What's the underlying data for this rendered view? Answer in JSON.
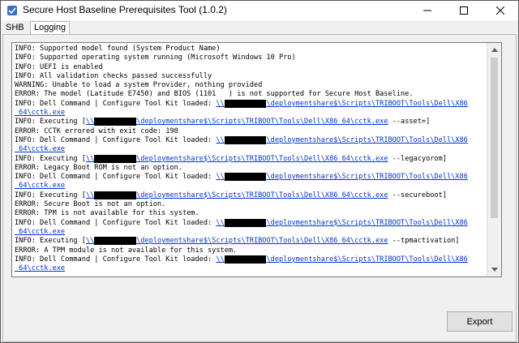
{
  "window": {
    "title": "Secure Host Baseline Prerequisites Tool (1.0.2)",
    "accent": "#3a70c4"
  },
  "tabs": [
    {
      "label": "SHB",
      "selected": false
    },
    {
      "label": "Logging",
      "selected": true
    }
  ],
  "log": {
    "lines": [
      [
        {
          "t": "INFO: Supported model found (System Product Name)"
        }
      ],
      [
        {
          "t": "INFO: Supported operating system running (Microsoft Windows 10 Pro)"
        }
      ],
      [
        {
          "t": "INFO: UEFI is enabled"
        }
      ],
      [
        {
          "t": "INFO: All validation checks passed successfully"
        }
      ],
      [
        {
          "t": "WARNING: Unable to load a system Provider, nothing provided"
        }
      ],
      [
        {
          "t": "ERROR: The model (Latitude E7450) and BIOS (1101   ) is not supported for Secure Host Baseline."
        }
      ],
      [
        {
          "t": "INFO: Dell Command | Configure Tool Kit loaded: "
        },
        {
          "t": "\\\\",
          "c": "link"
        },
        {
          "t": "          ",
          "c": "redact"
        },
        {
          "t": "\\deploymentshare$\\Scripts\\TRIBOOT\\Tools\\Dell\\X86",
          "c": "link"
        }
      ],
      [
        {
          "t": "_64\\cctk.exe",
          "c": "link"
        }
      ],
      [
        {
          "t": "INFO: Executing ["
        },
        {
          "t": "\\\\",
          "c": "link"
        },
        {
          "t": "          ",
          "c": "redact"
        },
        {
          "t": "\\deploymentshare$\\Scripts\\TRIBOOT\\Tools\\Dell\\X86_64\\cctk.exe",
          "c": "link"
        },
        {
          "t": " --asset=]"
        }
      ],
      [
        {
          "t": "ERROR: CCTK errored with exit code: 190"
        }
      ],
      [
        {
          "t": "INFO: Dell Command | Configure Tool Kit loaded: "
        },
        {
          "t": "\\\\",
          "c": "link"
        },
        {
          "t": "          ",
          "c": "redact"
        },
        {
          "t": "\\deploymentshare$\\Scripts\\TRIBOOT\\Tools\\Dell\\X86",
          "c": "link"
        }
      ],
      [
        {
          "t": "_64\\cctk.exe",
          "c": "link"
        }
      ],
      [
        {
          "t": "INFO: Executing ["
        },
        {
          "t": "\\\\",
          "c": "link"
        },
        {
          "t": "          ",
          "c": "redact"
        },
        {
          "t": "\\deploymentshare$\\Scripts\\TRIBOOT\\Tools\\Dell\\X86_64\\cctk.exe",
          "c": "link"
        },
        {
          "t": " --legacyorom]"
        }
      ],
      [
        {
          "t": "ERROR: Legacy Boot ROM is not an option."
        }
      ],
      [
        {
          "t": "INFO: Dell Command | Configure Tool Kit loaded: "
        },
        {
          "t": "\\\\",
          "c": "link"
        },
        {
          "t": "          ",
          "c": "redact"
        },
        {
          "t": "\\deploymentshare$\\Scripts\\TRIBOOT\\Tools\\Dell\\X86",
          "c": "link"
        }
      ],
      [
        {
          "t": "_64\\cctk.exe",
          "c": "link"
        }
      ],
      [
        {
          "t": "INFO: Executing ["
        },
        {
          "t": "\\\\",
          "c": "link"
        },
        {
          "t": "          ",
          "c": "redact"
        },
        {
          "t": "\\deploymentshare$\\Scripts\\TRIBOOT\\Tools\\Dell\\X86_64\\cctk.exe",
          "c": "link"
        },
        {
          "t": " --secureboot]"
        }
      ],
      [
        {
          "t": "ERROR: Secure Boot is not an option."
        }
      ],
      [
        {
          "t": "ERROR: TPM is not available for this system."
        }
      ],
      [
        {
          "t": "INFO: Dell Command | Configure Tool Kit loaded: "
        },
        {
          "t": "\\\\",
          "c": "link"
        },
        {
          "t": "          ",
          "c": "redact"
        },
        {
          "t": "\\deploymentshare$\\Scripts\\TRIBOOT\\Tools\\Dell\\X86",
          "c": "link"
        }
      ],
      [
        {
          "t": "_64\\cctk.exe",
          "c": "link"
        }
      ],
      [
        {
          "t": "INFO: Executing ["
        },
        {
          "t": "\\\\",
          "c": "link"
        },
        {
          "t": "          ",
          "c": "redact"
        },
        {
          "t": "\\deploymentshare$\\Scripts\\TRIBOOT\\Tools\\Dell\\X86_64\\cctk.exe",
          "c": "link"
        },
        {
          "t": " --tpmactivation]"
        }
      ],
      [
        {
          "t": "ERROR: A TPM module is not available for this system."
        }
      ],
      [
        {
          "t": "INFO: Dell Command | Configure Tool Kit loaded: "
        },
        {
          "t": "\\\\",
          "c": "link"
        },
        {
          "t": "          ",
          "c": "redact"
        },
        {
          "t": "\\deploymentshare$\\Scripts\\TRIBOOT\\Tools\\Dell\\X86",
          "c": "link"
        }
      ],
      [
        {
          "t": "_64\\cctk.exe",
          "c": "link"
        }
      ]
    ]
  },
  "buttons": {
    "export": "Export"
  },
  "icons": {
    "app": "app-icon",
    "minimize": "minimize-icon",
    "maximize": "maximize-icon",
    "close": "close-icon",
    "scroll_up": "scroll-up-arrow-icon",
    "scroll_down": "scroll-down-arrow-icon"
  }
}
